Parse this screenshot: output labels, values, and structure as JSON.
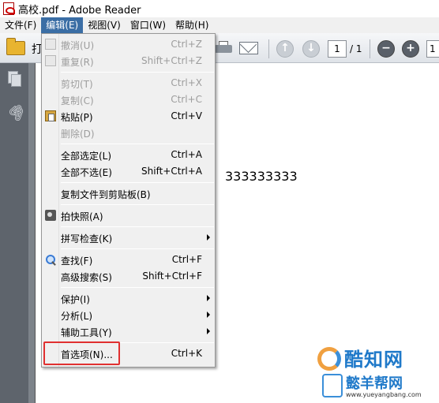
{
  "window": {
    "title": "高校.pdf - Adobe Reader"
  },
  "menubar": {
    "items": [
      "文件(F)",
      "编辑(E)",
      "视图(V)",
      "窗口(W)",
      "帮助(H)"
    ]
  },
  "toolbar": {
    "hidden_label": "打",
    "page_current": "1",
    "page_total": "/ 1",
    "zoom_value": "1"
  },
  "document": {
    "text": "333333333"
  },
  "edit_menu": {
    "items": [
      {
        "label": "撤消(U)",
        "shortcut": "Ctrl+Z"
      },
      {
        "label": "重复(R)",
        "shortcut": "Shift+Ctrl+Z"
      },
      {
        "label": "剪切(T)",
        "shortcut": "Ctrl+X"
      },
      {
        "label": "复制(C)",
        "shortcut": "Ctrl+C"
      },
      {
        "label": "粘贴(P)",
        "shortcut": "Ctrl+V"
      },
      {
        "label": "删除(D)",
        "shortcut": ""
      },
      {
        "label": "全部选定(L)",
        "shortcut": "Ctrl+A"
      },
      {
        "label": "全部不选(E)",
        "shortcut": "Shift+Ctrl+A"
      },
      {
        "label": "复制文件到剪贴板(B)",
        "shortcut": ""
      },
      {
        "label": "拍快照(A)",
        "shortcut": ""
      },
      {
        "label": "拼写检查(K)",
        "shortcut": ""
      },
      {
        "label": "查找(F)",
        "shortcut": "Ctrl+F"
      },
      {
        "label": "高级搜索(S)",
        "shortcut": "Shift+Ctrl+F"
      },
      {
        "label": "保护(I)",
        "shortcut": ""
      },
      {
        "label": "分析(L)",
        "shortcut": ""
      },
      {
        "label": "辅助工具(Y)",
        "shortcut": ""
      },
      {
        "label": "首选项(N)...",
        "shortcut": "Ctrl+K"
      }
    ]
  },
  "watermark": {
    "line1": "酷知网",
    "line2": "懿羊帮网",
    "url": "www.yueyangbang.com"
  },
  "colors": {
    "menu_highlight": "#3b6ea5",
    "callout_border": "#e03030"
  }
}
